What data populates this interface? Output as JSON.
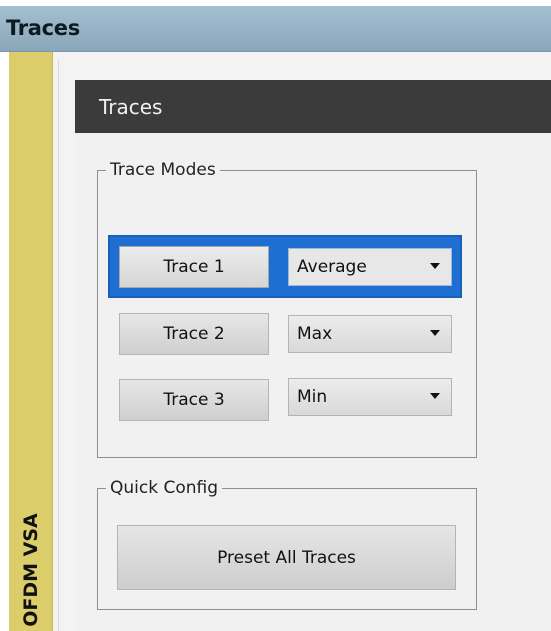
{
  "window": {
    "title": "Traces"
  },
  "sidetab": {
    "label": "OFDM VSA"
  },
  "panel": {
    "title": "Traces",
    "trace_modes": {
      "legend": "Trace Modes",
      "rows": [
        {
          "button_label": "Trace 1",
          "mode": "Average",
          "selected": true
        },
        {
          "button_label": "Trace 2",
          "mode": "Max",
          "selected": false
        },
        {
          "button_label": "Trace 3",
          "mode": "Min",
          "selected": false
        }
      ]
    },
    "quick_config": {
      "legend": "Quick Config",
      "preset_button_label": "Preset All Traces"
    }
  },
  "colors": {
    "title_bar": "#97b1c4",
    "side_tab": "#dccd6b",
    "panel_header": "#3b3b3b",
    "selection_highlight": "#1f6fd2"
  },
  "icons": {
    "dropdown_arrow": "chevron-down-icon"
  }
}
